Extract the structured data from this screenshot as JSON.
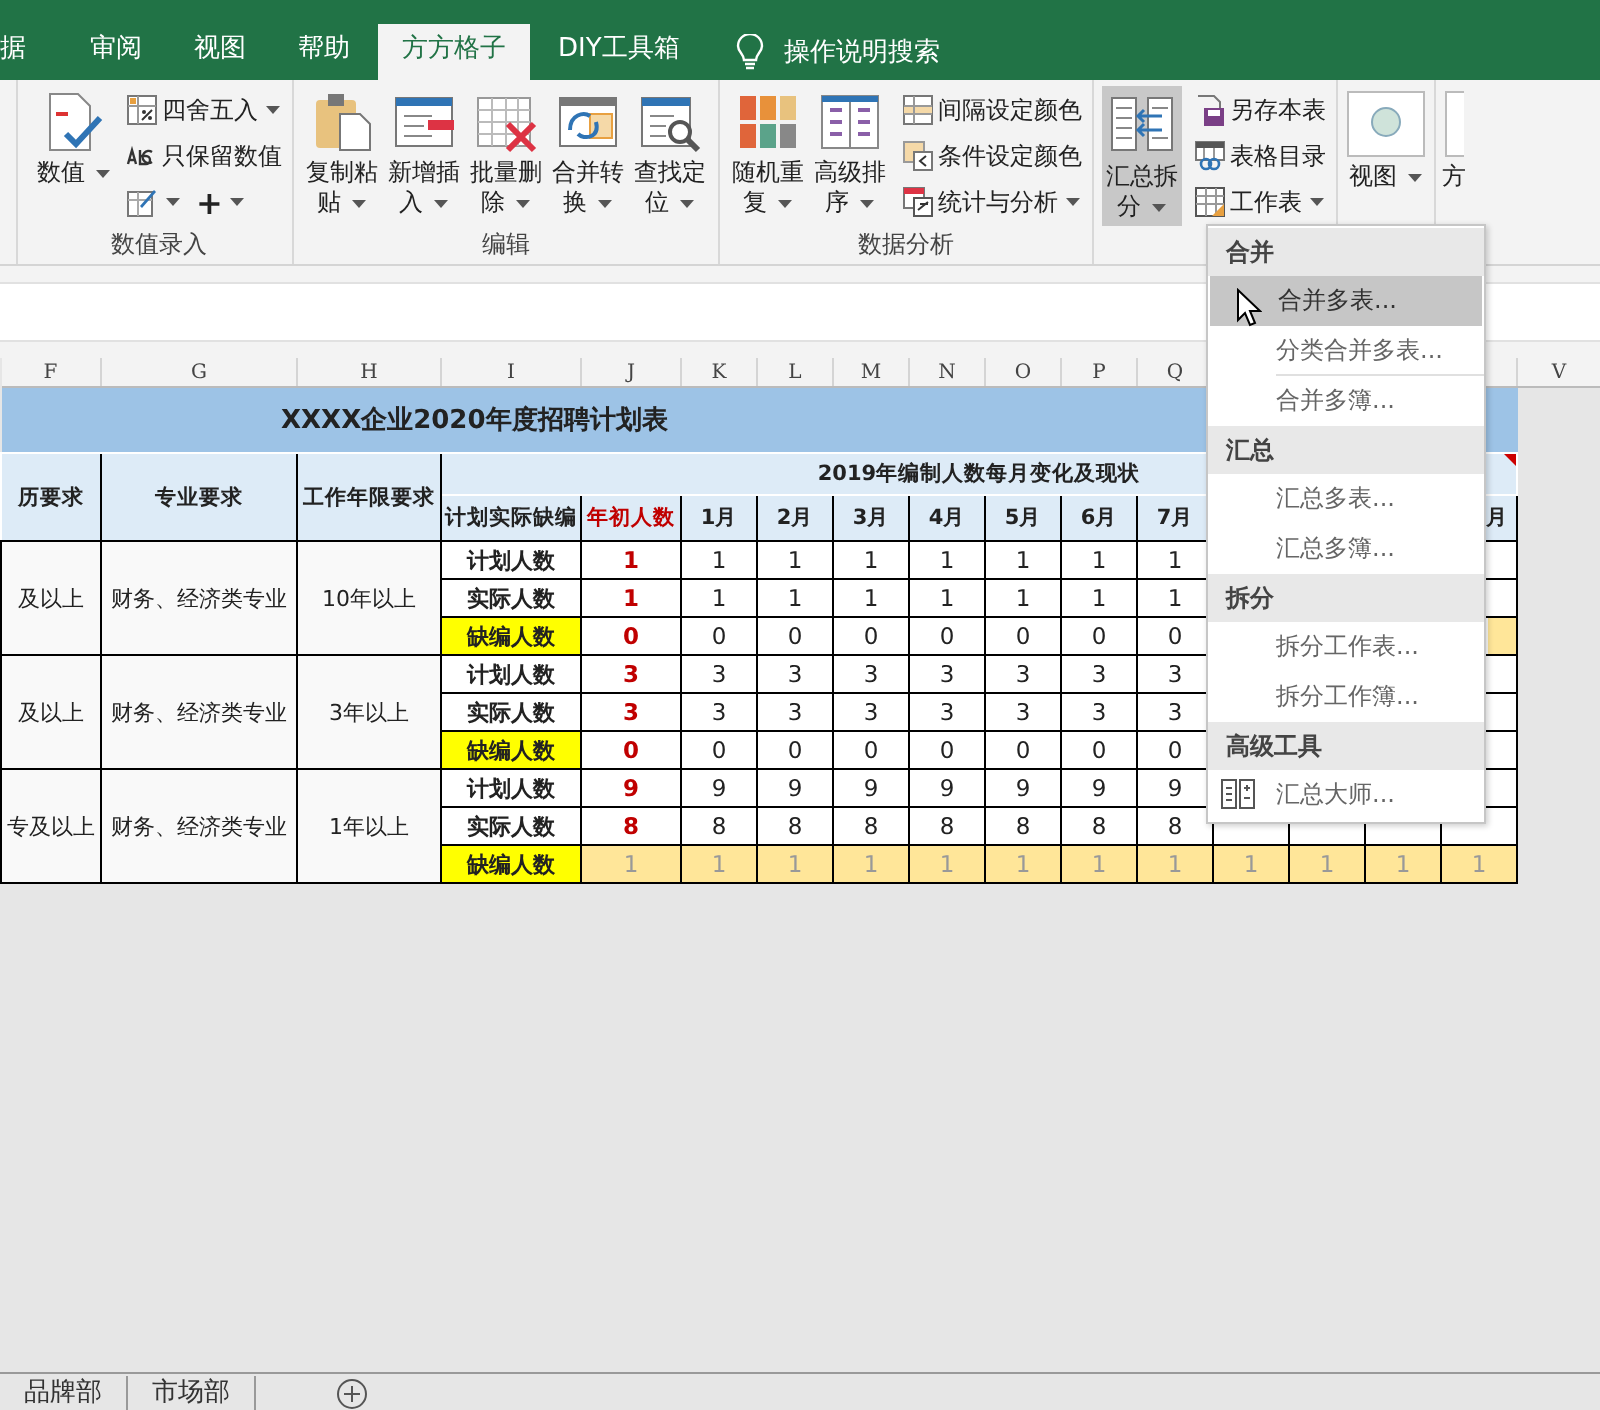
{
  "ribbon_tabs": [
    {
      "label": "据",
      "selected": false
    },
    {
      "label": "审阅",
      "selected": false
    },
    {
      "label": "视图",
      "selected": false
    },
    {
      "label": "帮助",
      "selected": false
    },
    {
      "label": "方方格子",
      "selected": true
    },
    {
      "label": "DIY工具箱",
      "selected": false
    }
  ],
  "tell_me": {
    "label": "操作说明搜索"
  },
  "ribbon_groups": [
    {
      "label": "数值录入",
      "items": [
        {
          "kind": "large",
          "label": "数值",
          "dropdown": true,
          "pressed": false
        },
        {
          "kind": "column",
          "items": [
            {
              "kind": "button",
              "label": "四舍五入",
              "dropdown": true
            },
            {
              "kind": "button",
              "label": "只保留数值",
              "dropdown": false
            },
            {
              "kind": "row",
              "parts": [
                {
                  "dropdown": true
                },
                {
                  "label": "+",
                  "dropdown": true
                }
              ]
            }
          ]
        }
      ]
    },
    {
      "label": "编辑",
      "items": [
        {
          "kind": "large",
          "label": "复制粘贴",
          "dropdown": true,
          "pressed": false
        },
        {
          "kind": "large",
          "label": "新增插入",
          "dropdown": true,
          "pressed": false
        },
        {
          "kind": "large",
          "label": "批量删除",
          "dropdown": true,
          "pressed": false
        },
        {
          "kind": "large",
          "label": "合并转换",
          "dropdown": true,
          "pressed": false
        },
        {
          "kind": "large",
          "label": "查找定位",
          "dropdown": true,
          "pressed": false
        }
      ]
    },
    {
      "label": "数据分析",
      "items": [
        {
          "kind": "large",
          "label": "随机重复",
          "dropdown": true,
          "pressed": false
        },
        {
          "kind": "large",
          "label": "高级排序",
          "dropdown": true,
          "pressed": false
        },
        {
          "kind": "column",
          "items": [
            {
              "kind": "button",
              "label": "间隔设定颜色",
              "dropdown": false
            },
            {
              "kind": "button",
              "label": "条件设定颜色",
              "dropdown": false
            },
            {
              "kind": "button",
              "label": "统计与分析",
              "dropdown": true
            }
          ]
        }
      ]
    },
    {
      "items": [
        {
          "kind": "large",
          "label": "汇总拆分",
          "dropdown": true,
          "pressed": true
        },
        {
          "kind": "column",
          "items": [
            {
              "kind": "button",
              "label": "另存本表",
              "dropdown": false
            },
            {
              "kind": "button",
              "label": "表格目录",
              "dropdown": false
            },
            {
              "kind": "button",
              "label": "工作表",
              "dropdown": true
            }
          ]
        }
      ]
    },
    {
      "items": [
        {
          "kind": "large",
          "label": "视图",
          "dropdown": true,
          "pressed": false
        }
      ]
    },
    {
      "items": [
        {
          "kind": "large",
          "label": "方",
          "dropdown": false,
          "pressed": false
        }
      ]
    }
  ],
  "sheet": {
    "column_letters": [
      "F",
      "G",
      "H",
      "I",
      "J",
      "K",
      "L",
      "M",
      "N",
      "O",
      "P",
      "Q"
    ],
    "column_letters_after_menu": [
      "V"
    ],
    "title": "XXXX企业2020年度招聘计划表",
    "header": {
      "education": "历要求",
      "major": "专业要求",
      "experience": "工作年限要求",
      "group_heading": "2019年编制人数每月变化及现状",
      "type_heading": "计划实际缺编",
      "months": [
        "年初人数",
        "1月",
        "2月",
        "3月",
        "4月",
        "5月",
        "6月",
        "7月"
      ],
      "months_tail": "月"
    },
    "positions": [
      {
        "education": "及以上",
        "major": "财务、经济类专业",
        "experience": "10年以上",
        "rows": [
          {
            "kind": "plan",
            "label": "计划人数",
            "values": [
              "1",
              "1",
              "1",
              "1",
              "1",
              "1",
              "1",
              "1"
            ],
            "filled": false,
            "tail_filled": false
          },
          {
            "kind": "actual",
            "label": "实际人数",
            "values": [
              "1",
              "1",
              "1",
              "1",
              "1",
              "1",
              "1",
              "1"
            ],
            "filled": false,
            "tail_filled": false
          },
          {
            "kind": "shortage",
            "label": "缺编人数",
            "values": [
              "0",
              "0",
              "0",
              "0",
              "0",
              "0",
              "0",
              "0"
            ],
            "filled": false,
            "tail_filled": true
          }
        ]
      },
      {
        "education": "及以上",
        "major": "财务、经济类专业",
        "experience": "3年以上",
        "rows": [
          {
            "kind": "plan",
            "label": "计划人数",
            "values": [
              "3",
              "3",
              "3",
              "3",
              "3",
              "3",
              "3",
              "3"
            ],
            "filled": false,
            "tail_filled": false
          },
          {
            "kind": "actual",
            "label": "实际人数",
            "values": [
              "3",
              "3",
              "3",
              "3",
              "3",
              "3",
              "3",
              "3"
            ],
            "filled": false,
            "tail_filled": false
          },
          {
            "kind": "shortage",
            "label": "缺编人数",
            "values": [
              "0",
              "0",
              "0",
              "0",
              "0",
              "0",
              "0",
              "0"
            ],
            "filled": false,
            "tail_filled": false
          }
        ]
      },
      {
        "education": "专及以上",
        "major": "财务、经济类专业",
        "experience": "1年以上",
        "rows": [
          {
            "kind": "plan",
            "label": "计划人数",
            "values": [
              "9",
              "9",
              "9",
              "9",
              "9",
              "9",
              "9",
              "9"
            ],
            "filled": false,
            "tail_filled": false
          },
          {
            "kind": "actual",
            "label": "实际人数",
            "values": [
              "8",
              "8",
              "8",
              "8",
              "8",
              "8",
              "8",
              "8"
            ],
            "filled": false,
            "tail_filled": false
          },
          {
            "kind": "shortage",
            "label": "缺编人数",
            "values": [
              "1",
              "1",
              "1",
              "1",
              "1",
              "1",
              "1",
              "1",
              "1",
              "1",
              "1",
              "1"
            ],
            "filled": true,
            "tail_filled": true
          }
        ]
      }
    ]
  },
  "dropdown_menu": {
    "items": [
      {
        "kind": "header",
        "label": "合并"
      },
      {
        "kind": "item",
        "label": "合并多表...",
        "highlighted": true,
        "separator_after": false
      },
      {
        "kind": "item",
        "label": "分类合并多表...",
        "highlighted": false,
        "separator_after": true
      },
      {
        "kind": "item",
        "label": "合并多簿...",
        "highlighted": false,
        "separator_after": false
      },
      {
        "kind": "header",
        "label": "汇总"
      },
      {
        "kind": "item",
        "label": "汇总多表...",
        "highlighted": false,
        "separator_after": false
      },
      {
        "kind": "item",
        "label": "汇总多簿...",
        "highlighted": false,
        "separator_after": false
      },
      {
        "kind": "header",
        "label": "拆分"
      },
      {
        "kind": "item",
        "label": "拆分工作表...",
        "highlighted": false,
        "separator_after": false
      },
      {
        "kind": "item",
        "label": "拆分工作簿...",
        "highlighted": false,
        "separator_after": false
      },
      {
        "kind": "header",
        "label": "高级工具"
      },
      {
        "kind": "tool",
        "label": "汇总大师...",
        "highlighted": false,
        "separator_after": false
      }
    ]
  },
  "sheet_tabs": [
    {
      "label": "品牌部",
      "selected": false
    },
    {
      "label": "市场部",
      "selected": false
    }
  ]
}
